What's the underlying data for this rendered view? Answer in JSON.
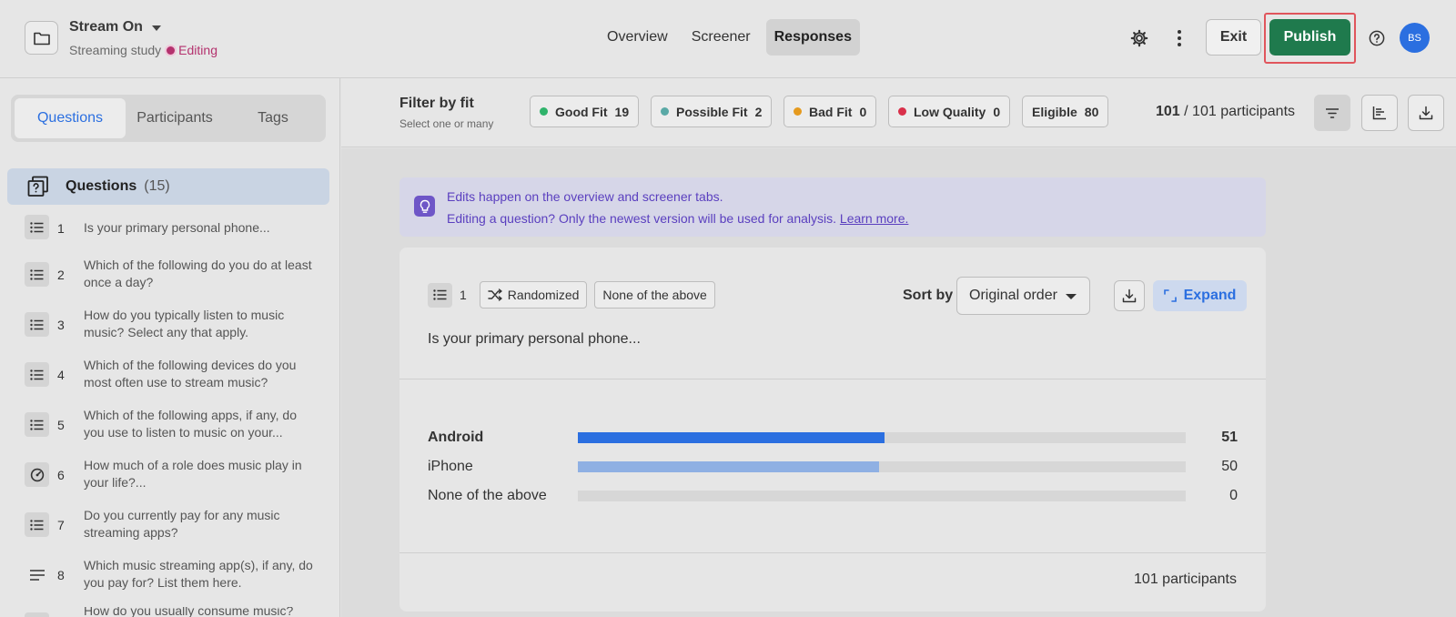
{
  "header": {
    "study_title": "Stream On",
    "study_subtitle": "Streaming study",
    "status": "Editing",
    "nav": [
      "Overview",
      "Screener",
      "Responses"
    ],
    "active_nav": "Responses",
    "exit_label": "Exit",
    "publish_label": "Publish",
    "avatar_initials": "BS"
  },
  "sidebar": {
    "tabs": [
      "Questions",
      "Participants",
      "Tags"
    ],
    "active_tab": "Questions",
    "questions_title": "Questions",
    "questions_count": "(15)",
    "items": [
      {
        "num": "1",
        "text": "Is your primary personal phone...",
        "icon": "list-icon"
      },
      {
        "num": "2",
        "text": "Which of the following do you do at least once a day?",
        "icon": "list-icon"
      },
      {
        "num": "3",
        "text": "How do you typically listen to music music? Select any that apply.",
        "icon": "list-icon"
      },
      {
        "num": "4",
        "text": "Which of the following devices do you most often use to stream music?",
        "icon": "list-icon"
      },
      {
        "num": "5",
        "text": "Which of the following apps, if any, do you use to listen to music on your...",
        "icon": "list-icon"
      },
      {
        "num": "6",
        "text": "How much of a role does music play in your life?...",
        "icon": "gauge-icon"
      },
      {
        "num": "7",
        "text": "Do you currently pay for any music streaming apps?",
        "icon": "list-icon"
      },
      {
        "num": "8",
        "text": "Which music streaming app(s), if any, do you pay for? List them here.",
        "icon": "text-lines-icon"
      },
      {
        "num": "",
        "text": "How do you usually consume music?",
        "icon": "list-icon"
      }
    ]
  },
  "filter": {
    "title": "Filter by fit",
    "subtitle": "Select one or many",
    "chips": [
      {
        "label": "Good Fit",
        "count": "19",
        "color": "#2fb36b"
      },
      {
        "label": "Possible Fit",
        "count": "2",
        "color": "#5aa9a6"
      },
      {
        "label": "Bad Fit",
        "count": "0",
        "color": "#e59a1e"
      },
      {
        "label": "Low Quality",
        "count": "0",
        "color": "#d9304a"
      },
      {
        "label": "Eligible",
        "count": "80",
        "color": ""
      }
    ],
    "participants_selected": "101",
    "participants_total": "/ 101 participants"
  },
  "info": {
    "line1": "Edits happen on the overview and screener tabs.",
    "line2": "Editing a question? Only the newest version will be used for analysis.",
    "link": "Learn more."
  },
  "question_card": {
    "number": "1",
    "tag_randomized": "Randomized",
    "tag_none": "None of the above",
    "sort_label": "Sort by",
    "sort_value": "Original order",
    "expand_label": "Expand",
    "question_text": "Is your primary personal phone...",
    "footer": "101 participants",
    "colors": {
      "primary": "#2b6fe0",
      "secondary": "#8fb0e3"
    }
  },
  "chart_data": {
    "type": "bar",
    "orientation": "horizontal",
    "categories": [
      "Android",
      "iPhone",
      "None of the above"
    ],
    "values": [
      51,
      50,
      0
    ],
    "total": 101
  }
}
